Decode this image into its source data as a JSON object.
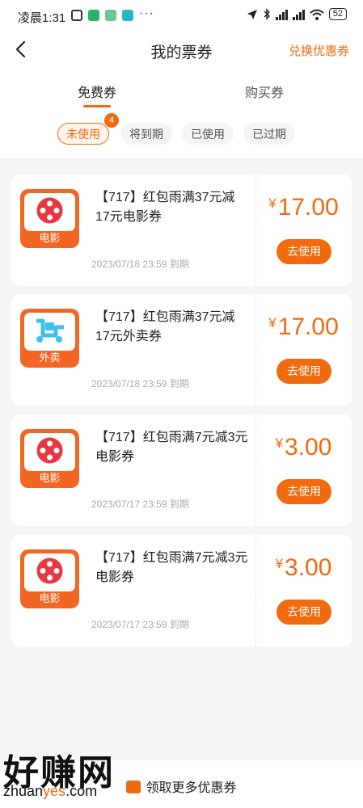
{
  "status_bar": {
    "time": "凌晨1:31",
    "more": "···",
    "battery": "52"
  },
  "nav": {
    "title": "我的票券",
    "exchange": "兑换优惠券"
  },
  "tabs": [
    {
      "label": "免费券",
      "active": true
    },
    {
      "label": "购买券",
      "active": false
    }
  ],
  "filters": [
    {
      "label": "未使用",
      "active": true
    },
    {
      "label": "将到期",
      "active": false
    },
    {
      "label": "已使用",
      "active": false
    },
    {
      "label": "已过期",
      "active": false
    }
  ],
  "unused_count": "4",
  "coupons": [
    {
      "icon": "movie-icon",
      "icon_label": "电影",
      "title": "【717】红包雨满37元减17元电影券",
      "currency": "¥",
      "amount": "17.00",
      "expire": "2023/07/18 23:59 到期",
      "button": "去使用"
    },
    {
      "icon": "scooter-icon",
      "icon_label": "外卖",
      "title": "【717】红包雨满37元减17元外卖券",
      "currency": "¥",
      "amount": "17.00",
      "expire": "2023/07/18 23:59 到期",
      "button": "去使用"
    },
    {
      "icon": "movie-icon",
      "icon_label": "电影",
      "title": "【717】红包雨满7元减3元电影券",
      "currency": "¥",
      "amount": "3.00",
      "expire": "2023/07/17 23:59 到期",
      "button": "去使用"
    },
    {
      "icon": "movie-icon",
      "icon_label": "电影",
      "title": "【717】红包雨满7元减3元电影券",
      "currency": "¥",
      "amount": "3.00",
      "expire": "2023/07/17 23:59 到期",
      "button": "去使用"
    }
  ],
  "bottom": {
    "more_link": "领取更多优惠券"
  },
  "watermark": {
    "brand": "好赚网",
    "url_prefix": "zhuan",
    "url_highlight": "yes",
    "url_suffix": ".com"
  },
  "colors": {
    "accent": "#f06a0f",
    "icon_orange": "#f26522",
    "scooter_blue": "#3ec1f0"
  }
}
